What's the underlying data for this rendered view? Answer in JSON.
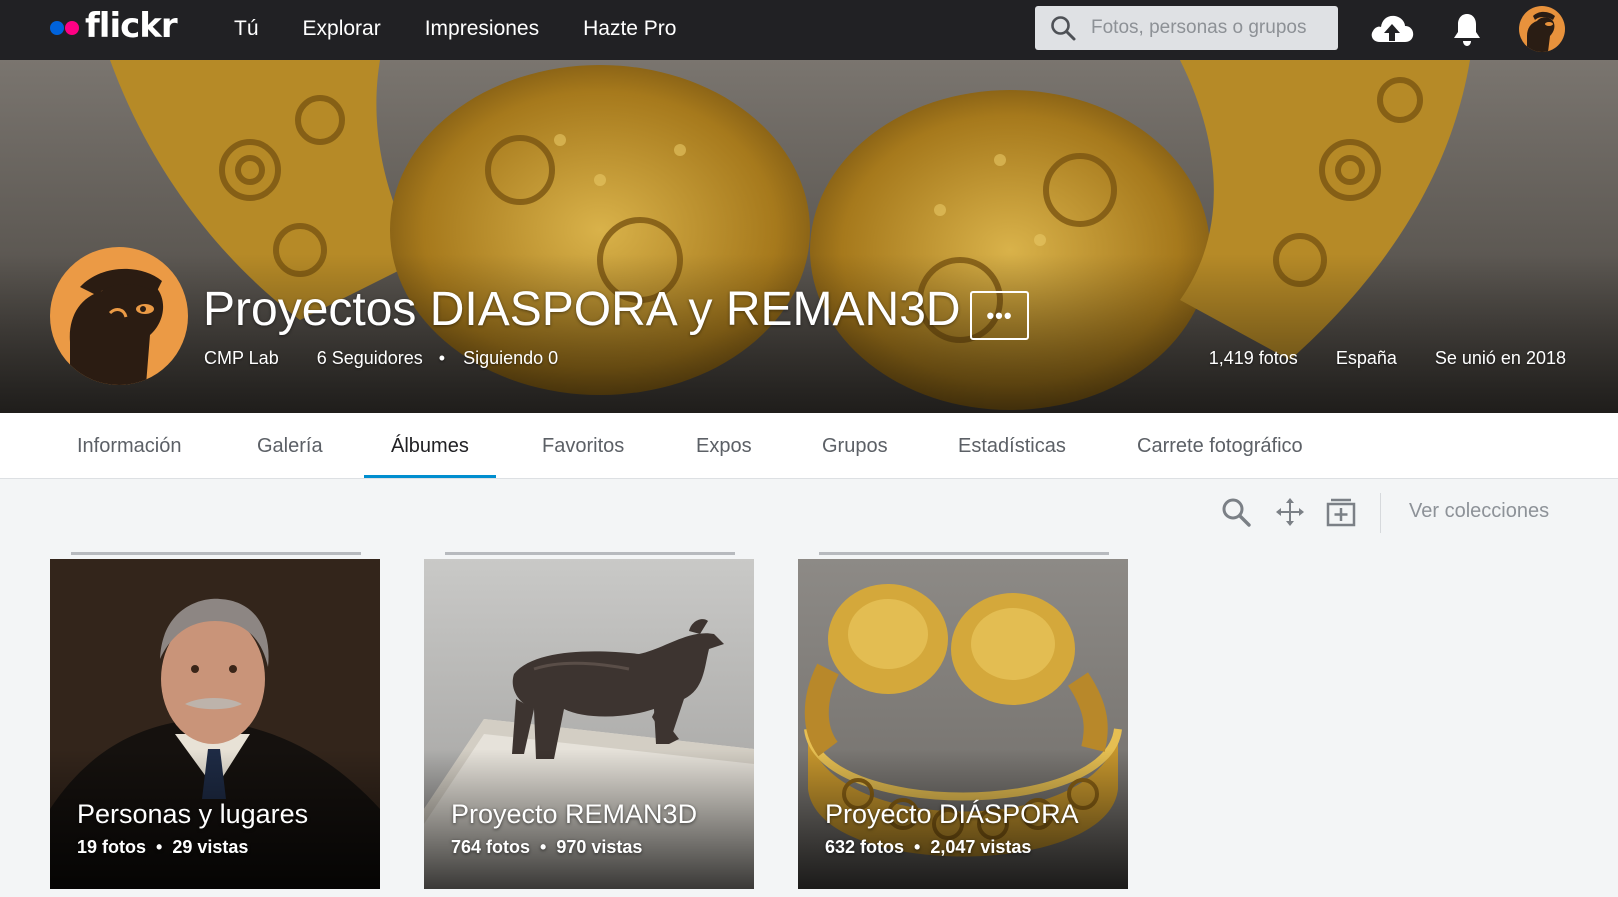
{
  "brand": {
    "logo_text": "flickr",
    "dot_colors": [
      "#0063dc",
      "#ff0084"
    ]
  },
  "topnav": {
    "items": [
      {
        "label": "Tú"
      },
      {
        "label": "Explorar"
      },
      {
        "label": "Impresiones"
      },
      {
        "label": "Hazte Pro"
      }
    ],
    "search_placeholder": "Fotos, personas o grupos",
    "icons": [
      "search-icon",
      "upload-cloud-icon",
      "notification-bell-icon",
      "user-avatar"
    ]
  },
  "profile": {
    "name": "Proyectos DIASPORA y REMAN3D",
    "more_label": "•••",
    "real_name": "CMP Lab",
    "followers": "6 Seguidores",
    "separator": "•",
    "following": "Siguiendo 0",
    "photo_count": "1,419 fotos",
    "location": "España",
    "joined": "Se unió en 2018"
  },
  "subnav": {
    "tabs": [
      {
        "label": "Información"
      },
      {
        "label": "Galería"
      },
      {
        "label": "Álbumes"
      },
      {
        "label": "Favoritos"
      },
      {
        "label": "Expos"
      },
      {
        "label": "Grupos"
      },
      {
        "label": "Estadísticas"
      },
      {
        "label": "Carrete fotográfico"
      }
    ],
    "active": "Álbumes",
    "accent_color": "#008ecf"
  },
  "toolbar": {
    "icons": [
      "search-icon",
      "arrange-icon",
      "add-album-icon"
    ],
    "ver_colecciones": "Ver colecciones"
  },
  "albums": [
    {
      "title": "Personas y lugares",
      "photos": "19 fotos",
      "views": "29 vistas",
      "bullet": "•"
    },
    {
      "title": "Proyecto REMAN3D",
      "photos": "764 fotos",
      "views": "970 vistas",
      "bullet": "•"
    },
    {
      "title": "Proyecto DIÁSPORA",
      "photos": "632 fotos",
      "views": "2,047 vistas",
      "bullet": "•"
    }
  ]
}
